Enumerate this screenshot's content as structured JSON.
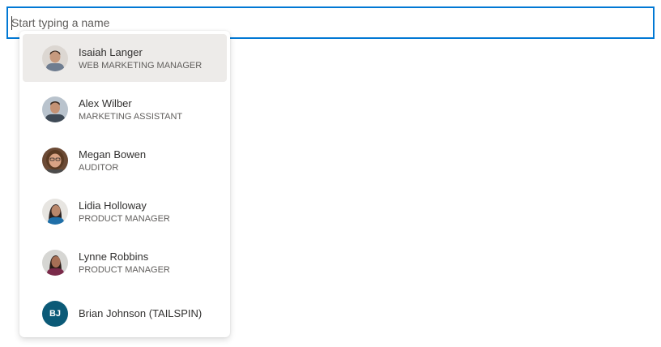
{
  "search": {
    "placeholder": "Start typing a name",
    "value": ""
  },
  "suggestions": [
    {
      "name": "Isaiah Langer",
      "title": "WEB MARKETING MANAGER",
      "selected": true,
      "photo_colors": {
        "bg": "#dcd7d2",
        "skin": "#c79a7e",
        "hair": "#3a2a22",
        "shirt": "#6f7d90"
      }
    },
    {
      "name": "Alex Wilber",
      "title": "MARKETING ASSISTANT",
      "selected": false,
      "photo_colors": {
        "bg": "#b9c3cd",
        "skin": "#c49274",
        "hair": "#3b2b20",
        "shirt": "#3f4a56"
      }
    },
    {
      "name": "Megan Bowen",
      "title": "AUDITOR",
      "selected": false,
      "photo_colors": {
        "bg": "#6b4a35",
        "skin": "#d9a384",
        "hair": "#5a3a22",
        "shirt": "#4c4c4c"
      }
    },
    {
      "name": "Lidia Holloway",
      "title": "PRODUCT MANAGER",
      "selected": false,
      "photo_colors": {
        "bg": "#e7e5e1",
        "skin": "#b9876b",
        "hair": "#2c2220",
        "shirt": "#1f6fa8"
      }
    },
    {
      "name": "Lynne Robbins",
      "title": "PRODUCT MANAGER",
      "selected": false,
      "photo_colors": {
        "bg": "#d6d6d3",
        "skin": "#a66f55",
        "hair": "#2b1d18",
        "shirt": "#7a2a4a"
      }
    },
    {
      "name": "Brian Johnson (TAILSPIN)",
      "title": "",
      "initials": "BJ",
      "selected": false,
      "photo_colors": {
        "bg": "#0b5a77"
      }
    }
  ]
}
